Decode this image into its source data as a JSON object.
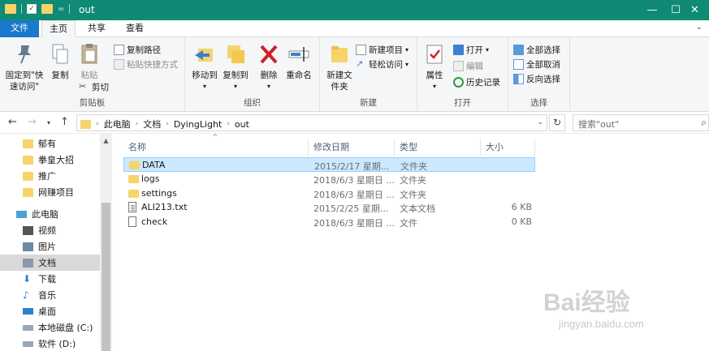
{
  "window": {
    "title": "out",
    "controls": {
      "minimize": "—",
      "maximize": "☐",
      "close": "✕"
    }
  },
  "quick_access_toolbar": {
    "separator": "="
  },
  "ribbon_tabs": [
    {
      "label": "文件"
    },
    {
      "label": "主页"
    },
    {
      "label": "共享"
    },
    {
      "label": "查看"
    }
  ],
  "ribbon": {
    "clipboard": {
      "label": "剪贴板",
      "pin": "固定到\"快速访问\"",
      "copy": "复制",
      "paste": "粘贴",
      "copy_path": "复制路径",
      "paste_shortcut": "粘贴快捷方式",
      "cut": "剪切"
    },
    "organize": {
      "label": "组织",
      "move_to": "移动到",
      "copy_to": "复制到",
      "delete": "删除",
      "rename": "重命名"
    },
    "new": {
      "label": "新建",
      "new_folder": "新建文件夹",
      "new_item": "新建项目",
      "easy_access": "轻松访问"
    },
    "open": {
      "label": "打开",
      "properties": "属性",
      "open": "打开",
      "edit": "编辑",
      "history": "历史记录"
    },
    "select": {
      "label": "选择",
      "select_all": "全部选择",
      "select_none": "全部取消",
      "invert": "反向选择"
    }
  },
  "address": {
    "crumbs": [
      "此电脑",
      "文档",
      "DyingLight",
      "out"
    ],
    "search_placeholder": "搜索\"out\""
  },
  "nav_pane": {
    "items": [
      {
        "label": "郁有",
        "icon": "folder-icon"
      },
      {
        "label": "拳皇大招",
        "icon": "folder-icon"
      },
      {
        "label": "推广",
        "icon": "folder-icon"
      },
      {
        "label": "网赚项目",
        "icon": "folder-icon"
      },
      {
        "label": "此电脑",
        "icon": "computer-icon"
      },
      {
        "label": "视频",
        "icon": "video-icon"
      },
      {
        "label": "图片",
        "icon": "pictures-icon"
      },
      {
        "label": "文档",
        "icon": "documents-icon"
      },
      {
        "label": "下载",
        "icon": "download-icon"
      },
      {
        "label": "音乐",
        "icon": "music-icon"
      },
      {
        "label": "桌面",
        "icon": "desktop-icon"
      },
      {
        "label": "本地磁盘 (C:)",
        "icon": "drive-icon"
      },
      {
        "label": "软件 (D:)",
        "icon": "drive-icon"
      }
    ]
  },
  "file_list": {
    "columns": [
      "名称",
      "修改日期",
      "类型",
      "大小"
    ],
    "rows": [
      {
        "name": "DATA",
        "modified": "2015/2/17 星期...",
        "type": "文件夹",
        "size": "",
        "icon": "folder-icon"
      },
      {
        "name": "logs",
        "modified": "2018/6/3 星期日 ...",
        "type": "文件夹",
        "size": "",
        "icon": "folder-icon"
      },
      {
        "name": "settings",
        "modified": "2018/6/3 星期日 ...",
        "type": "文件夹",
        "size": "",
        "icon": "folder-icon"
      },
      {
        "name": "ALI213.txt",
        "modified": "2015/2/25 星期...",
        "type": "文本文档",
        "size": "6 KB",
        "icon": "text-file-icon"
      },
      {
        "name": "check",
        "modified": "2018/6/3 星期日 ...",
        "type": "文件",
        "size": "0 KB",
        "icon": "file-icon"
      }
    ]
  },
  "watermark": {
    "line1": "Bai经验",
    "line2": "jingyan.baidu.com"
  },
  "colors": {
    "titlebar": "#0f8a74",
    "file_tab": "#1979ca",
    "selection": "#cce8ff",
    "folder": "#f6d46b"
  }
}
